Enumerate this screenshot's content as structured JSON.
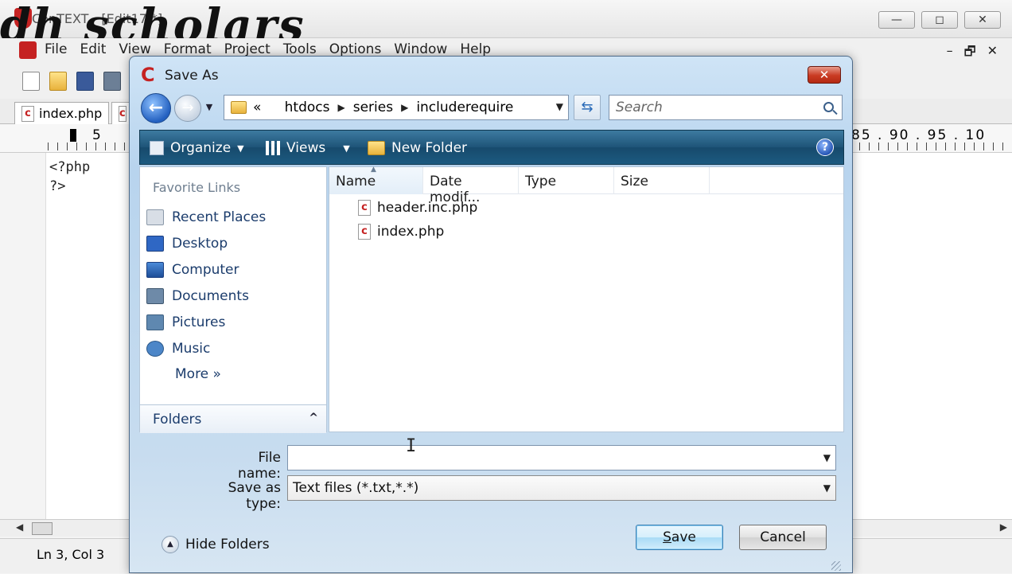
{
  "app": {
    "title": "ConTEXT - [Edit17 *]",
    "watermark": "dh scholars",
    "window_controls": {
      "minimize": "—",
      "maximize": "◻",
      "close": "✕"
    },
    "menu": [
      "File",
      "Edit",
      "View",
      "Format",
      "Project",
      "Tools",
      "Options",
      "Window",
      "Help"
    ],
    "mdi_controls": {
      "minimize": "–",
      "restore": "🗗",
      "close": "✕"
    },
    "tabs": [
      {
        "label": "index.php"
      },
      {
        "label": ""
      }
    ],
    "ruler": {
      "left_label": "5",
      "right_labels": "85 . 90 . 95 . 10"
    },
    "code_lines": [
      "<?php",
      "",
      "?>"
    ],
    "status": "Ln 3, Col 3"
  },
  "dialog": {
    "title": "Save As",
    "close_label": "✕",
    "address": {
      "prefix": "«",
      "crumbs": [
        "htdocs",
        "series",
        "includerequire"
      ]
    },
    "search_placeholder": "Search",
    "toolbar": {
      "organize": "Organize",
      "views": "Views",
      "new_folder": "New Folder",
      "help": "?"
    },
    "favorite_links": {
      "title": "Favorite Links",
      "items": [
        "Recent Places",
        "Desktop",
        "Computer",
        "Documents",
        "Pictures",
        "Music"
      ],
      "more": "More  »"
    },
    "folders": {
      "label": "Folders",
      "toggle": "^"
    },
    "columns": [
      "Name",
      "Date modif...",
      "Type",
      "Size"
    ],
    "files": [
      {
        "name": "header.inc.php"
      },
      {
        "name": "index.php"
      }
    ],
    "file_name": {
      "label": "File name:",
      "value": ""
    },
    "save_as_type": {
      "label": "Save as type:",
      "value": "Text files (*.txt,*.*)"
    },
    "hide_folders": "Hide Folders",
    "buttons": {
      "save_prefix": "",
      "save_underlined": "S",
      "save_rest": "ave",
      "cancel": "Cancel"
    }
  },
  "colors": {
    "accent": "#1e5478",
    "link": "#1b3c6c",
    "brand": "#c52222"
  }
}
